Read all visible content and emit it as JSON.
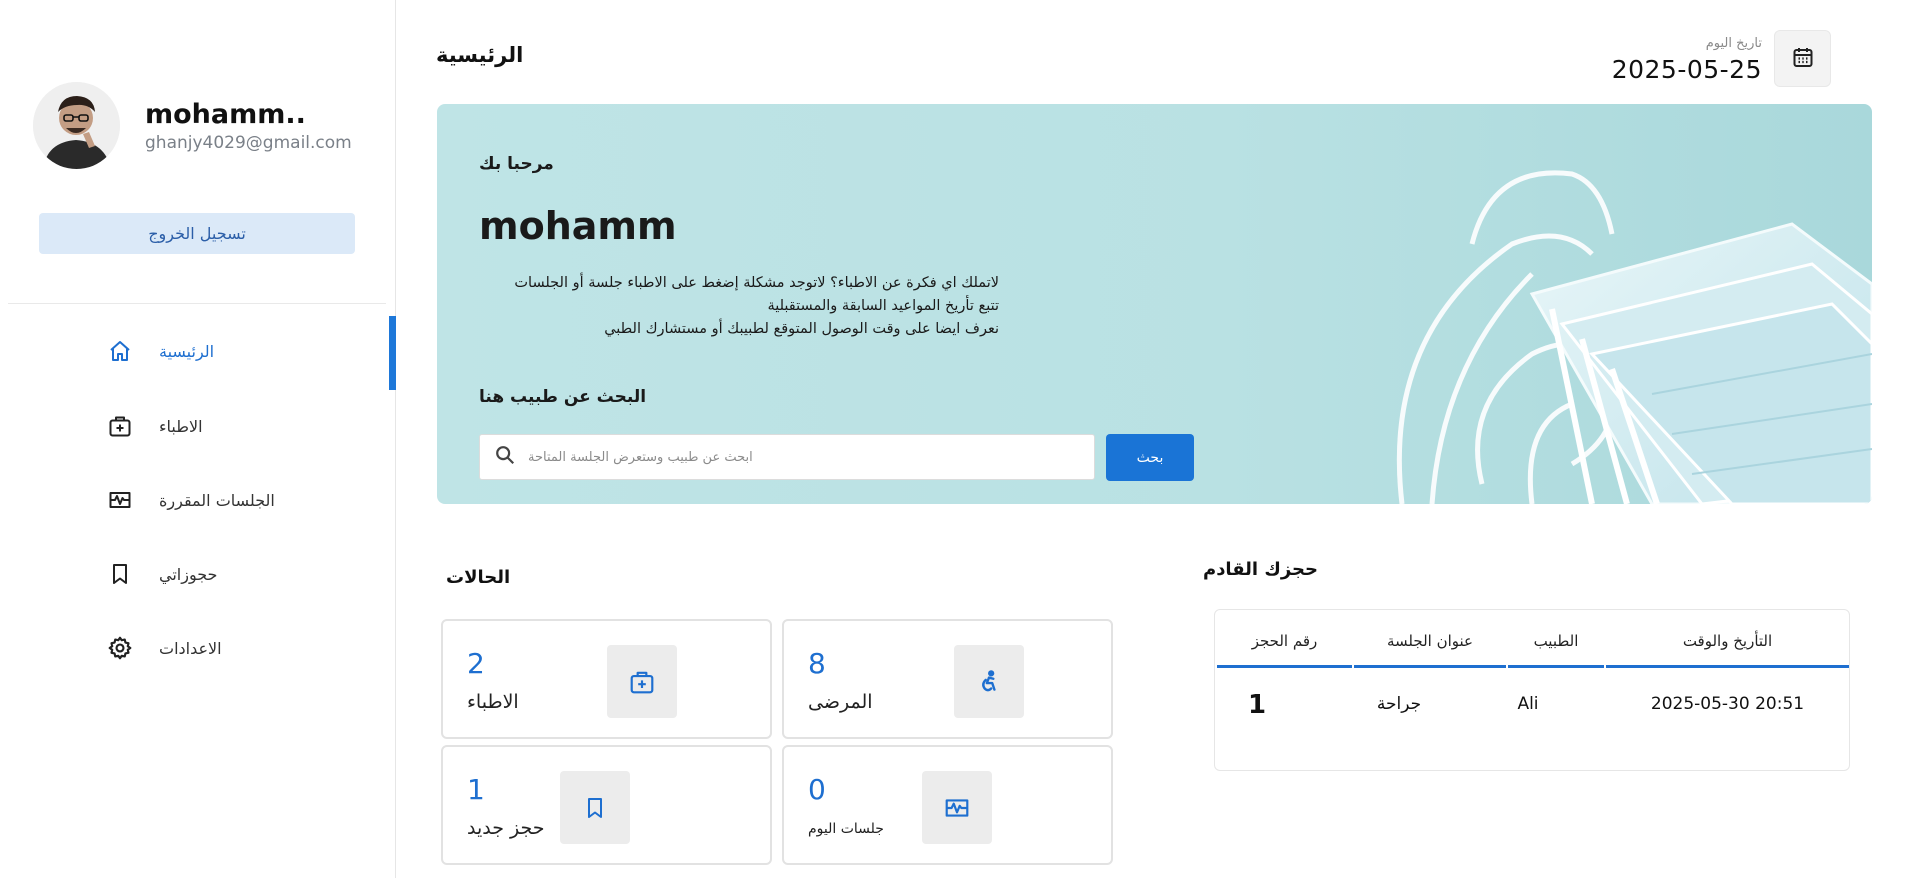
{
  "sidebar": {
    "profile": {
      "name": "mohamm..",
      "email": "ghanjy4029@gmail.com"
    },
    "logout_label": "تسجيل الخروج",
    "items": [
      {
        "label": "الرئيسية",
        "icon": "home-icon",
        "active": true
      },
      {
        "label": "الاطباء",
        "icon": "medical-bag-icon",
        "active": false
      },
      {
        "label": "الجلسات المقررة",
        "icon": "vital-signs-icon",
        "active": false
      },
      {
        "label": "حجوزاتي",
        "icon": "bookmark-icon",
        "active": false
      },
      {
        "label": "الاعدادات",
        "icon": "gear-icon",
        "active": false
      }
    ]
  },
  "header": {
    "title": "الرئيسية",
    "date_label": "تاريخ اليوم",
    "date_value": "2025-05-25",
    "calendar_icon": "calendar-icon"
  },
  "banner": {
    "welcome": "مرحبا بك",
    "user_name": "mohamm",
    "description_line1": "لاتملك اي فكرة عن الاطباء؟ لاتوجد مشكلة إضغط على الاطباء جلسة أو الجلسات",
    "description_line2": "تتبع تأريخ المواعيد السابقة والمستقبلية",
    "description_line3": "نعرف ايضا على وقت الوصول المتوقع لطبيبك أو مستشارك الطبي",
    "search_title": "البحث عن طبيب هنا",
    "search_placeholder": "ابحث عن طبيب وستعرض الجلسة المتاحة",
    "search_button": "بحث"
  },
  "stats": {
    "title": "الحالات",
    "cards": [
      {
        "value": "2",
        "label": "الاطباء",
        "icon": "medical-bag-icon"
      },
      {
        "value": "8",
        "label": "المرضى",
        "icon": "accessible-icon"
      },
      {
        "value": "1",
        "label": "حجز جديد",
        "icon": "bookmark-icon"
      },
      {
        "value": "0",
        "label": "جلسات اليوم",
        "icon": "vital-signs-icon"
      }
    ]
  },
  "booking": {
    "title": "حجزك القادم",
    "columns": [
      "رقم الحجز",
      "عنوان الجلسة",
      "الطبيب",
      "التأريخ والوقت"
    ],
    "rows": [
      {
        "booking_id": "1",
        "session_title": "جراحة",
        "doctor": "Ali",
        "datetime": "2025-05-30 20:51"
      }
    ]
  },
  "colors": {
    "accent": "#1e6fd0",
    "banner_bg": "#bfe4e6",
    "logout_bg": "#dbe9f8"
  }
}
